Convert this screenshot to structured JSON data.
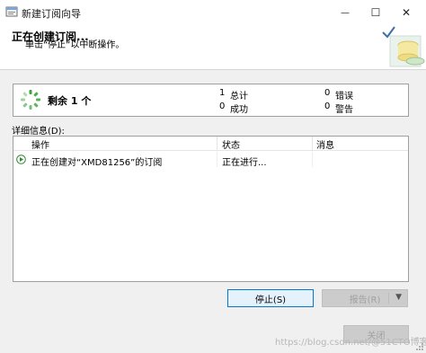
{
  "window": {
    "title": "新建订阅向导",
    "minimize_glyph": "—",
    "maximize_glyph": "☐",
    "close_glyph": "✕"
  },
  "header": {
    "title": "正在创建订阅...",
    "subtitle": "单击“停止”以中断操作。"
  },
  "summary": {
    "remaining_label": "剩余 1 个",
    "total_count": "1",
    "total_label": "总计",
    "success_count": "0",
    "success_label": "成功",
    "error_count": "0",
    "error_label": "错误",
    "warning_count": "0",
    "warning_label": "警告"
  },
  "details": {
    "label": "详细信息(D):",
    "columns": [
      "操作",
      "状态",
      "消息"
    ],
    "rows": [
      {
        "action": "正在创建对“XMD81256”的订阅",
        "status": "正在进行...",
        "message": "",
        "icon": "play-arrow-icon"
      }
    ]
  },
  "buttons": {
    "stop": "停止(S)",
    "report": "报告(R)",
    "report_arrow": "▼",
    "close": "关闭"
  },
  "watermark": "https://blog.csdn.net/@51CTO博客",
  "colors": {
    "spinner": "#3aa33a",
    "accent_blue": "#0078d7",
    "disabled_text": "#a0a0a0"
  }
}
